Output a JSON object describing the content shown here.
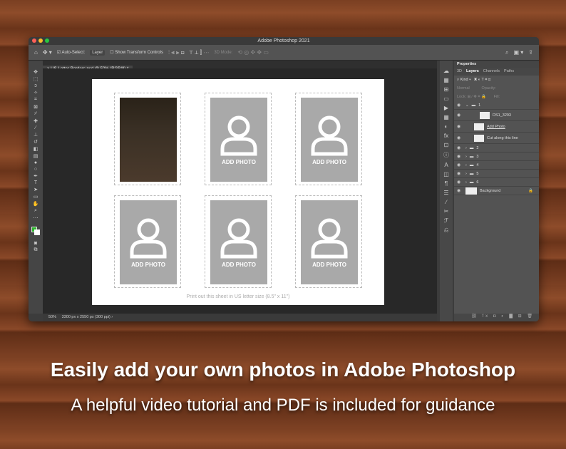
{
  "window": {
    "title": "Adobe Photoshop 2021",
    "tab": "US-Letter-Borders.psd @ 50% (RGB/8) *"
  },
  "options": {
    "auto_select": "Auto-Select:",
    "layer_select": "Layer",
    "show_transform": "Show Transform Controls",
    "mode_3d": "3D Mode:"
  },
  "document": {
    "placeholder_label": "ADD PHOTO",
    "note": "Print out this sheet in US letter size (8.5\" x 11\")"
  },
  "status": {
    "zoom": "50%",
    "info": "3300 px x 2550 px (300 ppi)"
  },
  "panel": {
    "title": "Properties",
    "tabs": [
      "3D",
      "Layers",
      "Channels",
      "Paths"
    ],
    "kind": "Kind",
    "blend": "Normal",
    "opacity": "Opacity:",
    "lock": "Lock:",
    "fill": "Fill:",
    "layers": [
      {
        "name": "1",
        "type": "group"
      },
      {
        "name": "DS1_3293",
        "type": "smart"
      },
      {
        "name": "Add Photo",
        "type": "smart"
      },
      {
        "name": "Cut along this line",
        "type": "layer"
      },
      {
        "name": "2",
        "type": "group"
      },
      {
        "name": "3",
        "type": "group"
      },
      {
        "name": "4",
        "type": "group"
      },
      {
        "name": "5",
        "type": "group"
      },
      {
        "name": "6",
        "type": "group"
      },
      {
        "name": "Background",
        "type": "background"
      }
    ]
  },
  "captions": {
    "headline": "Easily add your own photos in Adobe Photoshop",
    "sub": "A helpful video tutorial and PDF is included for guidance"
  }
}
